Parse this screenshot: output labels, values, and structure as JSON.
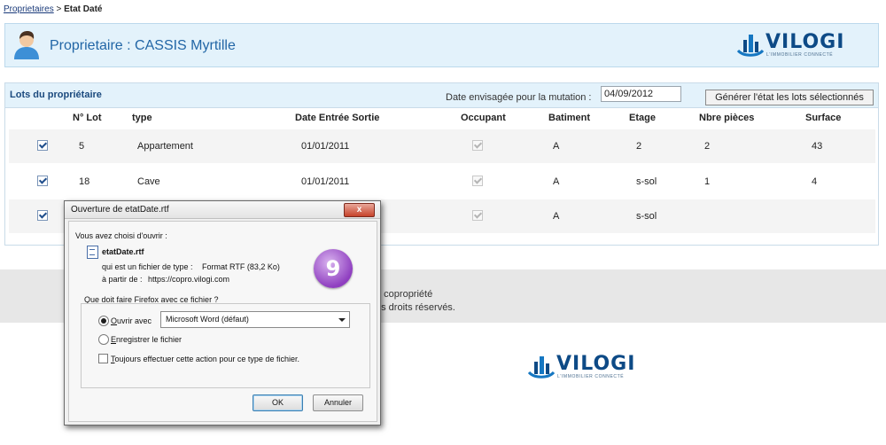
{
  "breadcrumb": {
    "link": "Proprietaires",
    "separator": " > ",
    "current": "Etat Daté"
  },
  "owner": {
    "title": "Proprietaire : CASSIS Myrtille",
    "avatar_icon": "user-avatar-icon"
  },
  "logo": {
    "word": "VILOGI",
    "tagline": "L'IMMOBILIER CONNECTÉ"
  },
  "lots": {
    "title": "Lots du propriétaire",
    "date_label": "Date envisagée pour la mutation :",
    "date_value": "04/09/2012",
    "generate_button": "Générer l'état les lots sélectionnés",
    "columns": [
      "N° Lot",
      "type",
      "Date Entrée Sortie",
      "Occupant",
      "Batiment",
      "Etage",
      "Nbre pièces",
      "Surface"
    ],
    "rows": [
      {
        "selected": true,
        "lot": "5",
        "type": "Appartement",
        "date": "01/01/2011",
        "occupant": true,
        "batiment": "A",
        "etage": "2",
        "pieces": "2",
        "surface": "43"
      },
      {
        "selected": true,
        "lot": "18",
        "type": "Cave",
        "date": "01/01/2011",
        "occupant": true,
        "batiment": "A",
        "etage": "s-sol",
        "pieces": "1",
        "surface": "4"
      },
      {
        "selected": true,
        "lot": "",
        "type": "",
        "date": "",
        "occupant": true,
        "batiment": "A",
        "etage": "s-sol",
        "pieces": "",
        "surface": ""
      }
    ]
  },
  "footer": {
    "line1": "e copropriété",
    "line2": "us droits réservés."
  },
  "dialog": {
    "title": "Ouverture de etatDate.rtf",
    "close": "x",
    "intro": "Vous avez choisi d'ouvrir :",
    "filename": "etatDate.rtf",
    "type_label": "qui est un fichier de type :",
    "type_value": "Format RTF (83,2 Ko)",
    "from_label": "à partir de :",
    "from_value": "https://copro.vilogi.com",
    "step_badge": "9",
    "question": "Que doit faire Firefox avec ce fichier ?",
    "open_with_first": "O",
    "open_with_rest": "uvrir avec",
    "open_with_app": "Microsoft Word (défaut)",
    "save_first": "E",
    "save_rest": "nregistrer le fichier",
    "always_first": "T",
    "always_rest": "oujours effectuer cette action pour ce type de fichier.",
    "ok": "OK",
    "cancel": "Annuler"
  }
}
